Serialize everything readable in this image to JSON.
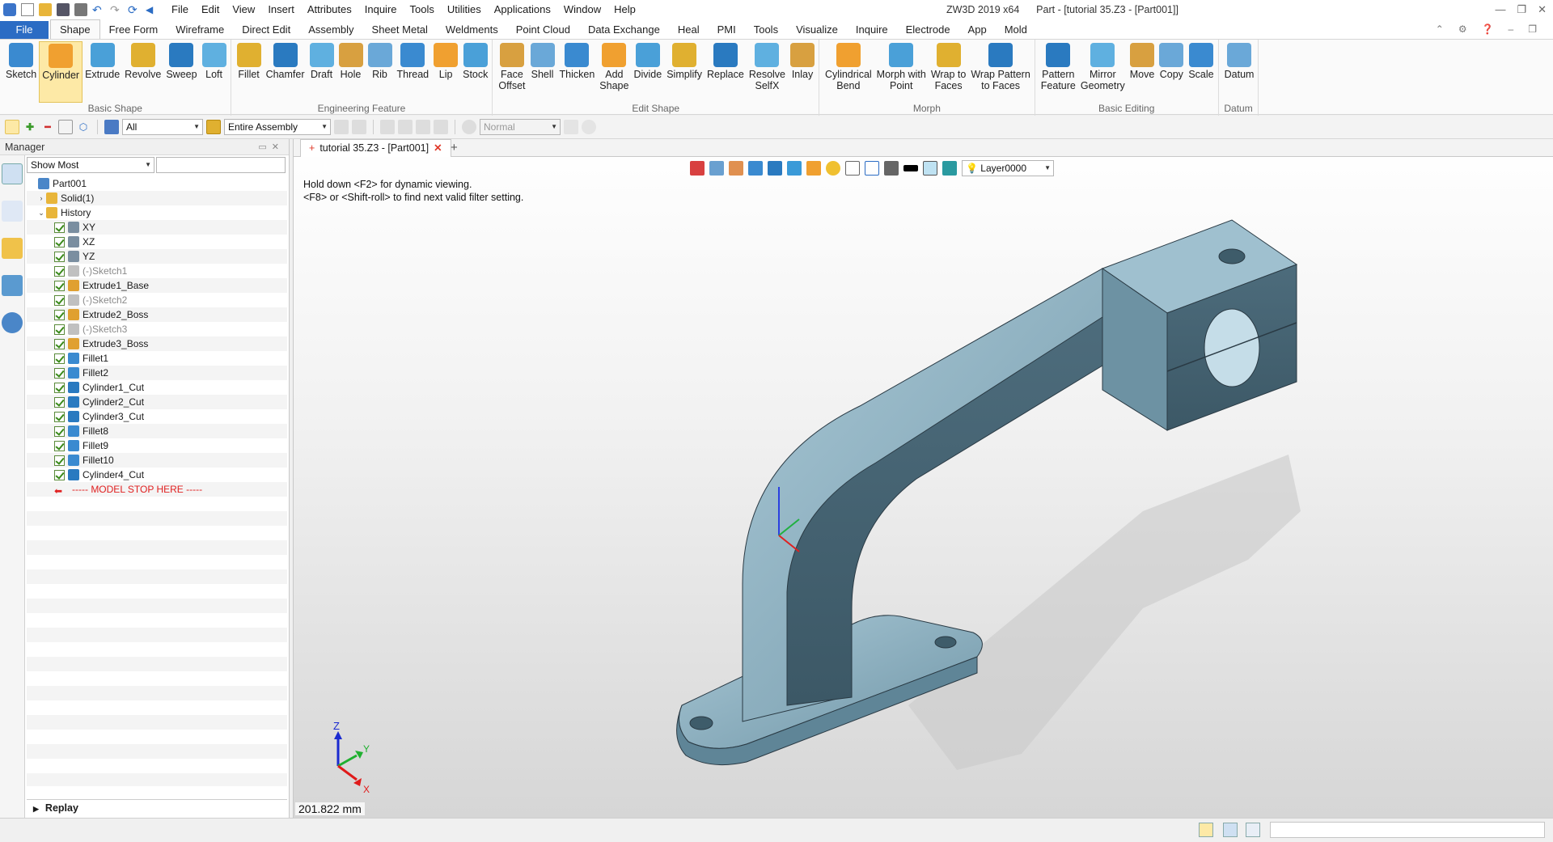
{
  "app": {
    "title": "ZW3D 2019  x64",
    "doc_title": "Part - [tutorial 35.Z3 - [Part001]]"
  },
  "menu": [
    "File",
    "Edit",
    "View",
    "Insert",
    "Attributes",
    "Inquire",
    "Tools",
    "Utilities",
    "Applications",
    "Window",
    "Help"
  ],
  "ribbon_tabs": [
    "File",
    "Shape",
    "Free Form",
    "Wireframe",
    "Direct Edit",
    "Assembly",
    "Sheet Metal",
    "Weldments",
    "Point Cloud",
    "Data Exchange",
    "Heal",
    "PMI",
    "Tools",
    "Visualize",
    "Inquire",
    "Electrode",
    "App",
    "Mold"
  ],
  "ribbon_groups": [
    {
      "label": "Basic Shape",
      "buttons": [
        {
          "label": "Sketch"
        },
        {
          "label": "Cylinder"
        },
        {
          "label": "Extrude"
        },
        {
          "label": "Revolve"
        },
        {
          "label": "Sweep"
        },
        {
          "label": "Loft"
        }
      ]
    },
    {
      "label": "Engineering Feature",
      "buttons": [
        {
          "label": "Fillet"
        },
        {
          "label": "Chamfer"
        },
        {
          "label": "Draft"
        },
        {
          "label": "Hole"
        },
        {
          "label": "Rib"
        },
        {
          "label": "Thread"
        },
        {
          "label": "Lip"
        },
        {
          "label": "Stock"
        }
      ]
    },
    {
      "label": "Edit Shape",
      "buttons": [
        {
          "label": "Face\nOffset"
        },
        {
          "label": "Shell"
        },
        {
          "label": "Thicken"
        },
        {
          "label": "Add\nShape"
        },
        {
          "label": "Divide"
        },
        {
          "label": "Simplify"
        },
        {
          "label": "Replace"
        },
        {
          "label": "Resolve\nSelfX"
        },
        {
          "label": "Inlay"
        }
      ]
    },
    {
      "label": "Morph",
      "buttons": [
        {
          "label": "Cylindrical\nBend"
        },
        {
          "label": "Morph with\nPoint"
        },
        {
          "label": "Wrap to\nFaces"
        },
        {
          "label": "Wrap Pattern\nto Faces"
        }
      ]
    },
    {
      "label": "Basic Editing",
      "buttons": [
        {
          "label": "Pattern\nFeature"
        },
        {
          "label": "Mirror\nGeometry"
        },
        {
          "label": "Move"
        },
        {
          "label": "Copy"
        },
        {
          "label": "Scale"
        }
      ]
    },
    {
      "label": "Datum",
      "buttons": [
        {
          "label": "Datum"
        }
      ]
    }
  ],
  "toolbar": {
    "filter_value": "All",
    "assembly_value": "Entire Assembly",
    "mode_value": "Normal"
  },
  "manager": {
    "title": "Manager",
    "filter_value": "Show Most",
    "tree": [
      {
        "label": "Part001",
        "level": 0,
        "exp": "",
        "chk": false,
        "icon": "part-icon",
        "dim": false,
        "stop": false
      },
      {
        "label": "Solid(1)",
        "level": 1,
        "exp": "›",
        "chk": false,
        "icon": "folder-icon",
        "dim": false,
        "stop": false
      },
      {
        "label": "History",
        "level": 1,
        "exp": "⌄",
        "chk": false,
        "icon": "folder-icon",
        "dim": false,
        "stop": false
      },
      {
        "label": "XY",
        "level": 2,
        "exp": "",
        "chk": true,
        "icon": "plane-icon",
        "dim": false,
        "stop": false
      },
      {
        "label": "XZ",
        "level": 2,
        "exp": "",
        "chk": true,
        "icon": "plane-icon",
        "dim": false,
        "stop": false
      },
      {
        "label": "YZ",
        "level": 2,
        "exp": "",
        "chk": true,
        "icon": "plane-icon",
        "dim": false,
        "stop": false
      },
      {
        "label": "(-)Sketch1",
        "level": 2,
        "exp": "",
        "chk": true,
        "icon": "sketch-icon",
        "dim": true,
        "stop": false
      },
      {
        "label": "Extrude1_Base",
        "level": 2,
        "exp": "",
        "chk": true,
        "icon": "feature-icon",
        "dim": false,
        "stop": false
      },
      {
        "label": "(-)Sketch2",
        "level": 2,
        "exp": "",
        "chk": true,
        "icon": "sketch-icon",
        "dim": true,
        "stop": false
      },
      {
        "label": "Extrude2_Boss",
        "level": 2,
        "exp": "",
        "chk": true,
        "icon": "feature-icon",
        "dim": false,
        "stop": false
      },
      {
        "label": "(-)Sketch3",
        "level": 2,
        "exp": "",
        "chk": true,
        "icon": "sketch-icon",
        "dim": true,
        "stop": false
      },
      {
        "label": "Extrude3_Boss",
        "level": 2,
        "exp": "",
        "chk": true,
        "icon": "feature-icon",
        "dim": false,
        "stop": false
      },
      {
        "label": "Fillet1",
        "level": 2,
        "exp": "",
        "chk": true,
        "icon": "fillet-icon",
        "dim": false,
        "stop": false
      },
      {
        "label": "Fillet2",
        "level": 2,
        "exp": "",
        "chk": true,
        "icon": "fillet-icon",
        "dim": false,
        "stop": false
      },
      {
        "label": "Cylinder1_Cut",
        "level": 2,
        "exp": "",
        "chk": true,
        "icon": "cylinder-icon",
        "dim": false,
        "stop": false
      },
      {
        "label": "Cylinder2_Cut",
        "level": 2,
        "exp": "",
        "chk": true,
        "icon": "cylinder-icon",
        "dim": false,
        "stop": false
      },
      {
        "label": "Cylinder3_Cut",
        "level": 2,
        "exp": "",
        "chk": true,
        "icon": "cylinder-icon",
        "dim": false,
        "stop": false
      },
      {
        "label": "Fillet8",
        "level": 2,
        "exp": "",
        "chk": true,
        "icon": "fillet-icon",
        "dim": false,
        "stop": false
      },
      {
        "label": "Fillet9",
        "level": 2,
        "exp": "",
        "chk": true,
        "icon": "fillet-icon",
        "dim": false,
        "stop": false
      },
      {
        "label": "Fillet10",
        "level": 2,
        "exp": "",
        "chk": true,
        "icon": "fillet-icon",
        "dim": false,
        "stop": false
      },
      {
        "label": "Cylinder4_Cut",
        "level": 2,
        "exp": "",
        "chk": true,
        "icon": "cylinder-icon",
        "dim": false,
        "stop": false
      },
      {
        "label": "----- MODEL STOP HERE -----",
        "level": 2,
        "exp": "",
        "chk": false,
        "icon": "stop-arrow-icon",
        "dim": false,
        "stop": true
      }
    ],
    "replay_label": "Replay"
  },
  "viewport": {
    "tab_label": "tutorial 35.Z3 - [Part001]",
    "layer": "Layer0000",
    "hint_line1": "Hold down <F2> for dynamic viewing.",
    "hint_line2": "<F8> or <Shift-roll> to find next valid filter setting.",
    "measure": "201.822 mm",
    "axis_x": "X",
    "axis_y": "Y",
    "axis_z": "Z"
  },
  "colors": {
    "accent": "#2b6cc4",
    "model": "#7fa4b4",
    "stop_text": "#e02020"
  }
}
